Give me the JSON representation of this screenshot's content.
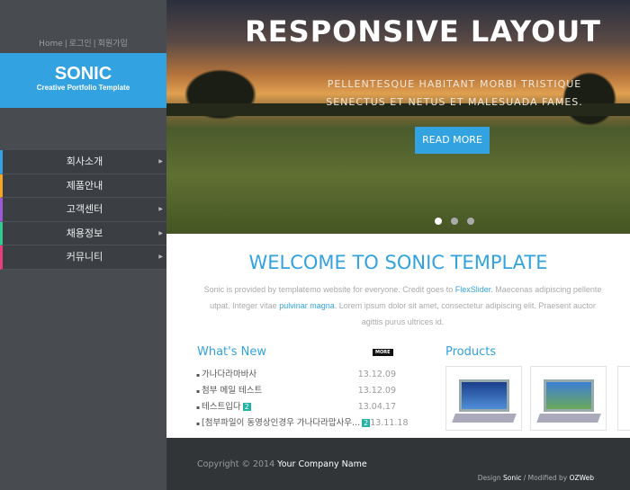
{
  "sidebar": {
    "top_links": [
      "Home",
      "로그인",
      "회원가입"
    ],
    "logo_title": "SONIC",
    "logo_subtitle": "Creative Portfolio Template",
    "menu": [
      {
        "label": "회사소개",
        "color": "#33a2e0",
        "has_sub": true
      },
      {
        "label": "제품안내",
        "color": "#f5a623",
        "has_sub": false
      },
      {
        "label": "고객센터",
        "color": "#9b59d6",
        "has_sub": true
      },
      {
        "label": "채용정보",
        "color": "#2ecc8f",
        "has_sub": true
      },
      {
        "label": "커뮤니티",
        "color": "#e83e7c",
        "has_sub": true
      }
    ]
  },
  "hero": {
    "title": "RESPONSIVE LAYOUT",
    "caption": "PELLENTESQUE HABITANT MORBI TRISTIQUE SENECTUS ET NETUS ET MALESUADA FAMES.",
    "button": "READ MORE",
    "slides": 3,
    "active_slide": 1
  },
  "welcome": {
    "title": "WELCOME TO SONIC TEMPLATE",
    "p1": "Sonic is provided by templatemo website for everyone. Credit goes to ",
    "link1": "FlexSlider",
    "p2": ". Maecenas adipiscing pellente",
    "p3": "utpat. Integer vitae ",
    "link2": "pulvinar magna",
    "p4": ". Lorem ipsum dolor sit amet, consectetur adipiscing elit. Praesent auctor",
    "p5": "agittis purus ultrices id."
  },
  "news": {
    "title": "What's New",
    "more": "MORE",
    "items": [
      {
        "title": "가나다라마바사",
        "date": "13.12.09",
        "badge": ""
      },
      {
        "title": "첨부 메일 테스트",
        "date": "13.12.09",
        "badge": ""
      },
      {
        "title": "테스트입다",
        "date": "13.04.17",
        "badge": "2"
      },
      {
        "title": "[첨부파일이 동영상인경우 가나다라맙사우...",
        "date": "13.11.18",
        "badge": "2"
      }
    ]
  },
  "products": {
    "title": "Products"
  },
  "footer": {
    "copy": "Copyright © 2014 ",
    "company": "Your Company Name",
    "design": "Design ",
    "sonic": "Sonic",
    "mod": " / Modified by ",
    "oz": "OZWeb"
  }
}
